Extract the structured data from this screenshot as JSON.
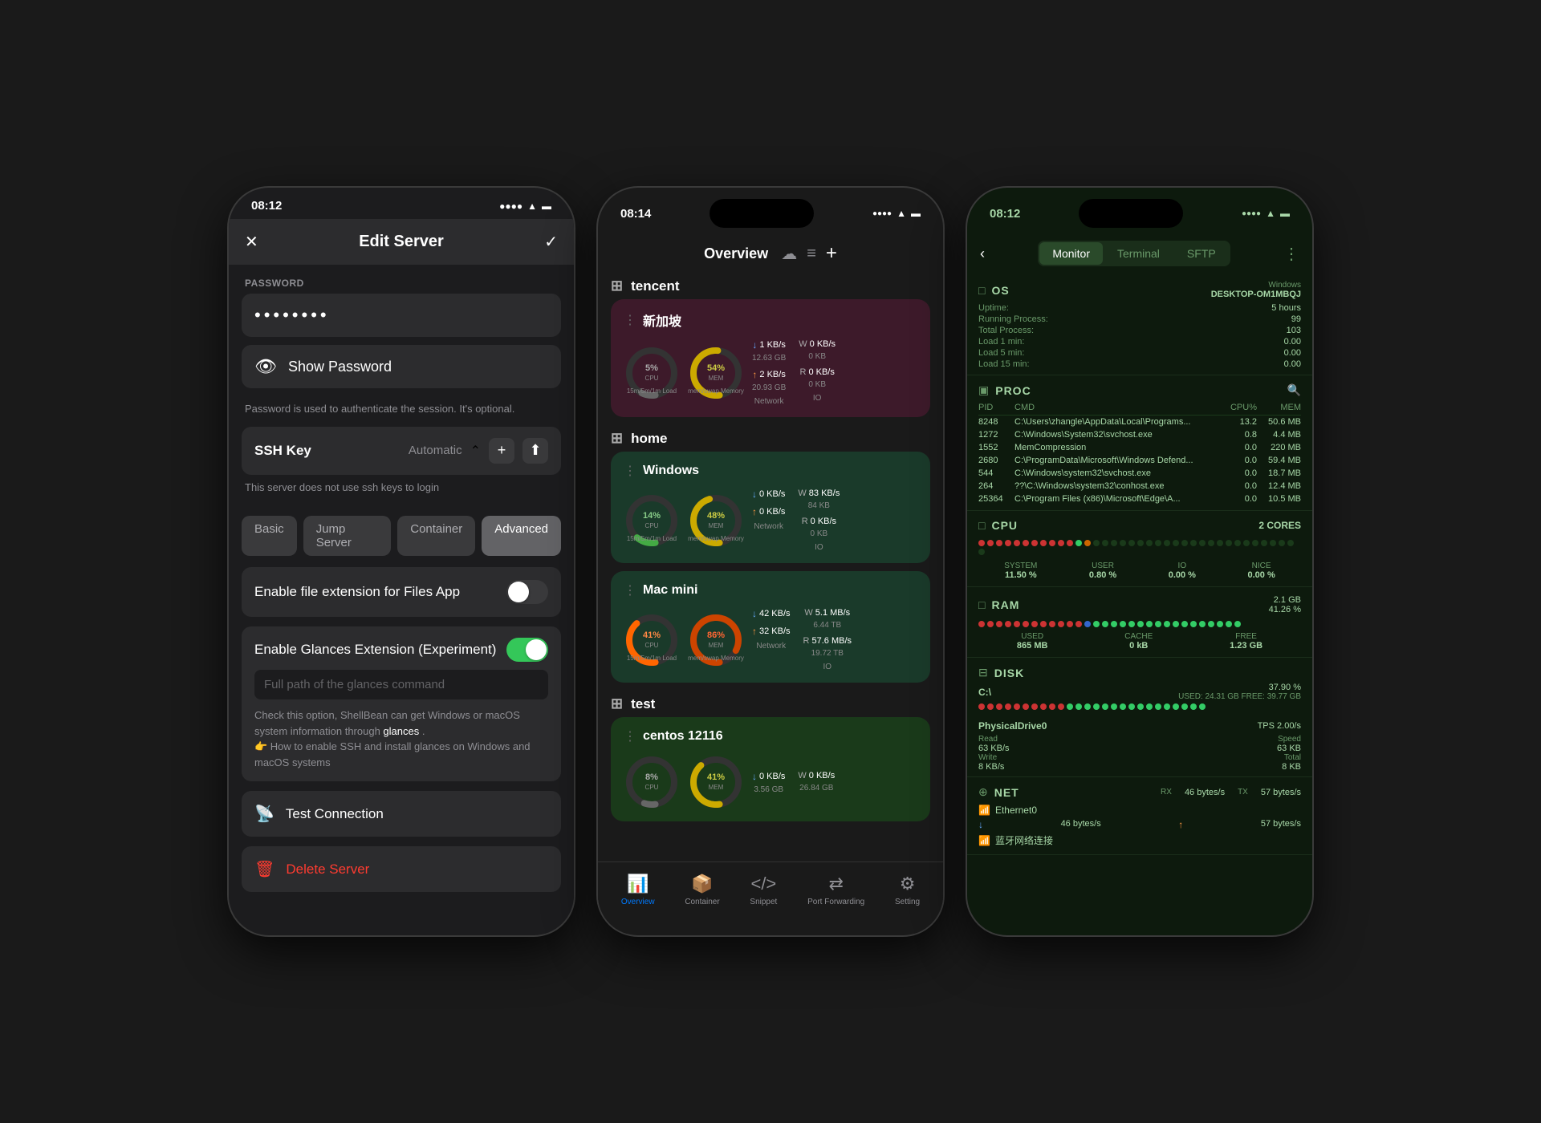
{
  "phone1": {
    "status_time": "08:12",
    "title": "Edit Server",
    "password_dots": "••••••••",
    "show_password_label": "Show Password",
    "password_hint": "Password is used to authenticate the session. It's optional.",
    "ssh_key_label": "SSH Key",
    "ssh_key_value": "Automatic",
    "ssh_key_hint": "This server does not use ssh keys to login",
    "tabs": [
      "Basic",
      "Jump Server",
      "Container",
      "Advanced"
    ],
    "active_tab": "Advanced",
    "toggle1_label": "Enable file extension for Files App",
    "toggle1_state": "off",
    "glances_label": "Enable Glances Extension (Experiment)",
    "glances_state": "on",
    "glances_placeholder": "Full path of the glances command",
    "glances_desc1": "Check this option, ShellBean can get Windows or macOS system information through",
    "glances_link": "glances",
    "glances_desc2": ".",
    "glances_desc3": "👉 How to enable SSH and install glances on Windows and macOS systems",
    "test_conn_label": "Test Connection",
    "delete_label": "Delete Server"
  },
  "phone2": {
    "status_time": "08:14",
    "title": "Overview",
    "groups": [
      {
        "name": "tencent",
        "servers": [
          {
            "name": "新加坡",
            "cpu": 5,
            "mem": 54,
            "cpu_label": "CPU",
            "mem_label": "MEM",
            "load_label": "15m/5m/1m\nLoad",
            "memory_label": "mem/swap\nMemory",
            "net_down": "1 KB/s\n12.63 GB",
            "net_up": "2 KB/s\n20.93 GB",
            "net_label": "Network",
            "io_w": "0 KB/s\n0 KB",
            "io_r": "0 KB/s\n0 KB",
            "io_label": "IO",
            "cpu_color": "#666",
            "mem_color": "#ccaa00"
          }
        ]
      },
      {
        "name": "home",
        "servers": [
          {
            "name": "Windows",
            "cpu": 14,
            "mem": 48,
            "net_down": "0 KB/s",
            "net_up": "0 KB/s",
            "net_label": "Network",
            "io_w": "83 KB/s\n84 KB",
            "io_r": "0 KB/s\n0 KB",
            "io_label": "IO",
            "cpu_color": "#44aa44",
            "mem_color": "#ccaa00"
          }
        ]
      },
      {
        "name": "test",
        "servers": [
          {
            "name": "centos 12116",
            "cpu": 8,
            "mem": 41,
            "net_down": "0 KB/s\n3.56 GB",
            "net_up": "",
            "io_w": "0 KB/s\n26.84 GB",
            "cpu_color": "#666",
            "mem_color": "#ccaa00"
          }
        ]
      }
    ],
    "nav": [
      "Overview",
      "Container",
      "Snippet",
      "Port Forwarding",
      "Setting"
    ]
  },
  "phone2_mac": {
    "name": "Mac mini",
    "cpu": 41,
    "mem": 86,
    "net_down": "42 KB/s",
    "net_up": "32 KB/s",
    "io_w": "5.1 MB/s\n6.44 TB",
    "io_r": "57.6 MB/s\n19.72 TB"
  },
  "phone3": {
    "status_time": "08:12",
    "tabs": [
      "Monitor",
      "Terminal",
      "SFTP"
    ],
    "active_tab": "Monitor",
    "os_section": {
      "title": "OS",
      "hostname": "DESKTOP-OM1MBQJ",
      "platform": "Windows",
      "uptime": "5 hours",
      "running_process": "99",
      "total_process": "103",
      "load_1min": "0.00",
      "load_5min": "0.00",
      "load_15min": "0.00"
    },
    "proc_section": {
      "title": "PROC",
      "processes": [
        {
          "pid": "8248",
          "cmd": "C:\\Users\\zhangle\\AppData\\Local\\Programs...",
          "cpu": "13.2",
          "mem": "50.6 MB"
        },
        {
          "pid": "1272",
          "cmd": "C:\\Windows\\System32\\svchost.exe",
          "cpu": "0.8",
          "mem": "4.4 MB"
        },
        {
          "pid": "1552",
          "cmd": "MemCompression",
          "cpu": "0.0",
          "mem": "220 MB"
        },
        {
          "pid": "2680",
          "cmd": "C:\\ProgramData\\Microsoft\\Windows Defend...",
          "cpu": "0.0",
          "mem": "59.4 MB"
        },
        {
          "pid": "544",
          "cmd": "C:\\Windows\\system32\\svchost.exe",
          "cpu": "0.0",
          "mem": "18.7 MB"
        },
        {
          "pid": "264",
          "cmd": "??\\C:\\Windows\\system32\\conhost.exe",
          "cpu": "0.0",
          "mem": "12.4 MB"
        },
        {
          "pid": "25364",
          "cmd": "C:\\Program Files (x86)\\Microsoft\\Edge\\A...",
          "cpu": "0.0",
          "mem": "10.5 MB"
        }
      ]
    },
    "cpu_section": {
      "title": "CPU",
      "cores": "2 CORES",
      "system": "11.50 %",
      "user": "0.80 %",
      "io": "0.00 %",
      "nice": "0.00 %"
    },
    "ram_section": {
      "title": "RAM",
      "total": "2.1 GB",
      "pct": "41.26 %",
      "used": "865 MB",
      "cache": "0 kB",
      "free": "1.23 GB"
    },
    "disk_section": {
      "title": "DISK",
      "path": "C:\\",
      "used_pct": "37.90 %",
      "used_info": "USED: 24.31 GB FREE: 39.77 GB",
      "drive": "PhysicalDrive0",
      "tps": "TPS 2.00/s",
      "read_speed": "63 KB/s",
      "write_speed": "8 KB/s",
      "read_total": "63 KB",
      "write_total": "8 KB"
    },
    "net_section": {
      "title": "NET",
      "rx": "46 bytes/s",
      "tx": "57 bytes/s",
      "eth_name": "Ethernet0",
      "eth_down": "46 bytes/s",
      "eth_up": "57 bytes/s",
      "bt_name": "蓝牙网络连接"
    }
  }
}
